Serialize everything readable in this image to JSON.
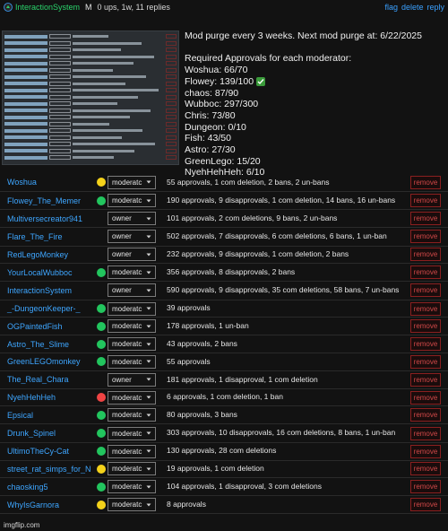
{
  "header": {
    "user": "InteractionSystem",
    "badge": "M",
    "meta": "0 ups, 1w, 11 replies",
    "links": [
      "flag",
      "delete",
      "reply"
    ]
  },
  "info_lines": [
    "Mod purge every 3 weeks. Next mod purge at: 6/22/2025",
    "",
    "Required Approvals for each moderator:",
    "Woshua: 66/70",
    "Flowey: 139/100",
    "chaos: 87/90",
    "Wubboc: 297/300",
    "Chris: 73/80",
    "Dungeon: 0/10",
    "Fish: 43/50",
    "Astro: 27/30",
    "GreenLego: 15/20",
    "NyehHehHeh: 6/10"
  ],
  "colors": {
    "green": "#22c55e",
    "yellow": "#f4d21a",
    "red": "#ef4444",
    "blue": "#3ea6ff"
  },
  "mods": [
    {
      "name": "Woshua",
      "status": "yellow",
      "role": "moderatc",
      "stats": "55 approvals, 1 com deletion, 2 bans, 2 un-bans",
      "remove": "remove"
    },
    {
      "name": "Flowey_The_Memer",
      "status": "green",
      "role": "moderatc",
      "stats": "190 approvals, 9 disapprovals, 1 com deletion, 14 bans, 16 un-bans",
      "remove": "remove"
    },
    {
      "name": "Multiversecreator941",
      "status": "",
      "role": "owner",
      "stats": "101 approvals, 2 com deletions, 9 bans, 2 un-bans",
      "remove": "remove"
    },
    {
      "name": "Flare_The_Fire",
      "status": "",
      "role": "owner",
      "stats": "502 approvals, 7 disapprovals, 6 com deletions, 6 bans, 1 un-ban",
      "remove": "remove"
    },
    {
      "name": "RedLegoMonkey",
      "status": "",
      "role": "owner",
      "stats": "232 approvals, 9 disapprovals, 1 com deletion, 2 bans",
      "remove": "remove"
    },
    {
      "name": "YourLocalWubboc",
      "status": "green",
      "role": "moderatc",
      "stats": "356 approvals, 8 disapprovals, 2 bans",
      "remove": "remove"
    },
    {
      "name": "InteractionSystem",
      "status": "",
      "role": "owner",
      "stats": "590 approvals, 9 disapprovals, 35 com deletions, 58 bans, 7 un-bans",
      "remove": "remove"
    },
    {
      "name": "_-DungeonKeeper-_",
      "status": "green",
      "role": "moderatc",
      "stats": "39 approvals",
      "remove": "remove"
    },
    {
      "name": "OGPaintedFish",
      "status": "green",
      "role": "moderatc",
      "stats": "178 approvals, 1 un-ban",
      "remove": "remove"
    },
    {
      "name": "Astro_The_Slime",
      "status": "green",
      "role": "moderatc",
      "stats": "43 approvals, 2 bans",
      "remove": "remove"
    },
    {
      "name": "GreenLEGOmonkey",
      "status": "green",
      "role": "moderatc",
      "stats": "55 approvals",
      "remove": "remove"
    },
    {
      "name": "The_Real_Chara",
      "status": "",
      "role": "owner",
      "stats": "181 approvals, 1 disapproval, 1 com deletion",
      "remove": "remove"
    },
    {
      "name": "NyehHehHeh",
      "status": "red",
      "role": "moderatc",
      "stats": "6 approvals, 1 com deletion, 1 ban",
      "remove": "remove"
    },
    {
      "name": "Epsical",
      "status": "green",
      "role": "moderatc",
      "stats": "80 approvals, 3 bans",
      "remove": "remove"
    },
    {
      "name": "Drunk_Spinel",
      "status": "green",
      "role": "moderatc",
      "stats": "303 approvals, 10 disapprovals, 16 com deletions, 8 bans, 1 un-ban",
      "remove": "remove"
    },
    {
      "name": "UltimoTheCy-Cat",
      "status": "green",
      "role": "moderatc",
      "stats": "130 approvals, 28 com deletions",
      "remove": "remove"
    },
    {
      "name": "street_rat_simps_for_N",
      "status": "yellow",
      "role": "moderatc",
      "stats": "19 approvals, 1 com deletion",
      "remove": "remove"
    },
    {
      "name": "chaosking5",
      "status": "green",
      "role": "moderatc",
      "stats": "104 approvals, 1 disapproval, 3 com deletions",
      "remove": "remove"
    },
    {
      "name": "WhyIsGarnora",
      "status": "yellow",
      "role": "moderatc",
      "stats": "8 approvals",
      "remove": "remove"
    }
  ],
  "watermark": "imgflip.com"
}
